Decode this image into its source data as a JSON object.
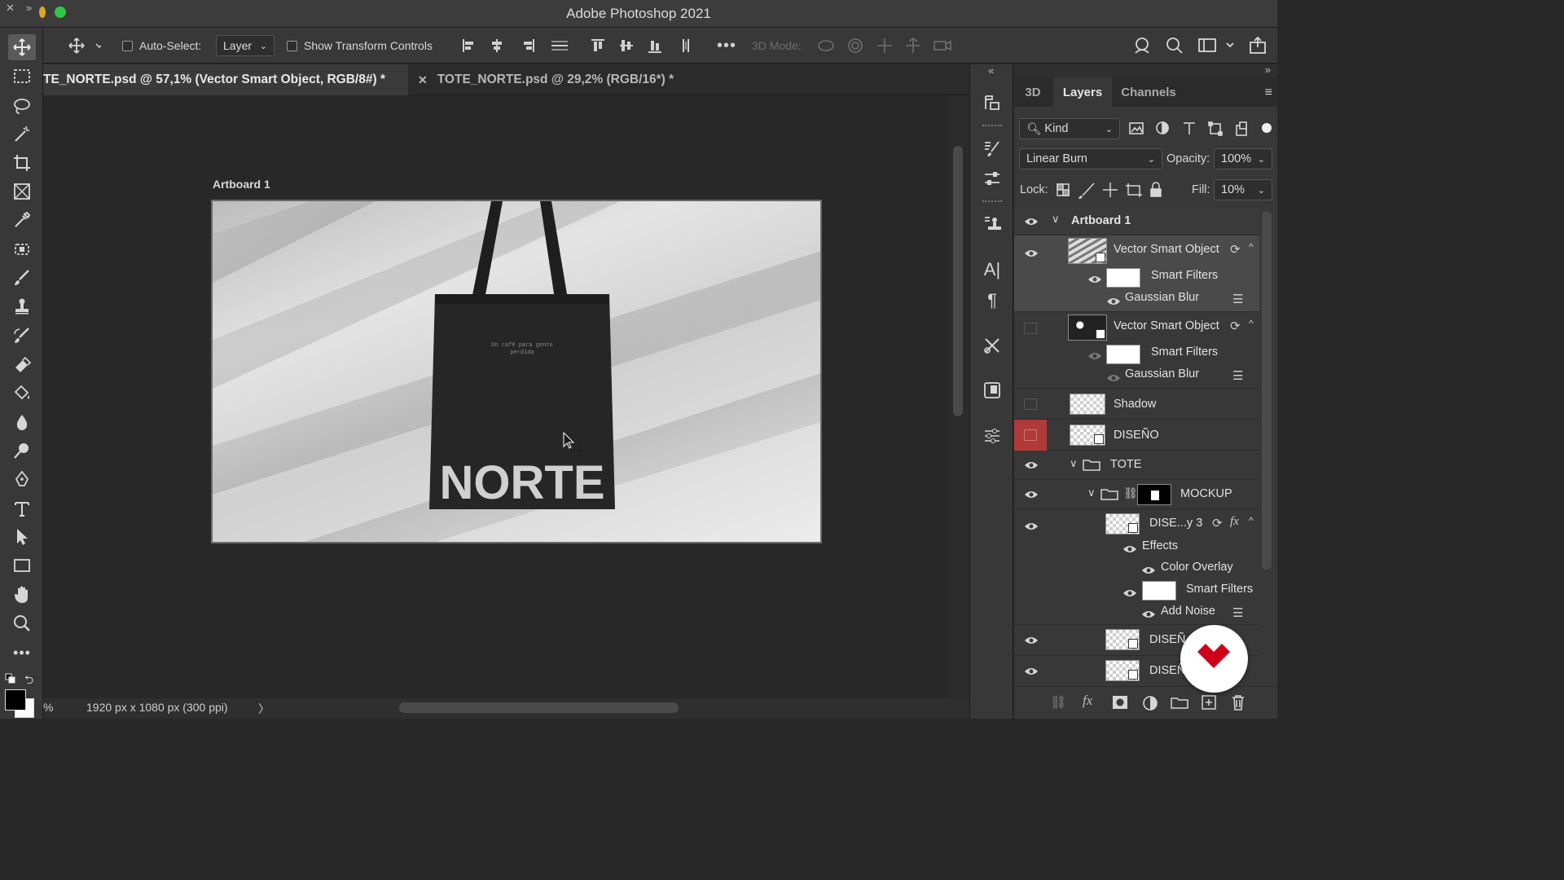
{
  "app": {
    "title": "Adobe Photoshop 2021"
  },
  "colors": {
    "accent_red": "#d0021b",
    "swatch_fg": "#000000",
    "swatch_bg": "#ffffff",
    "highlight_red": "#b03a3a"
  },
  "options_bar": {
    "auto_select_label": "Auto-Select:",
    "auto_select_target": "Layer",
    "show_transform_label": "Show Transform Controls",
    "mode_3d_label": "3D Mode:",
    "more_icon": "ellipsis-icon"
  },
  "tabs": [
    {
      "label": "TE_NORTE.psd @ 57,1% (Vector Smart Object, RGB/8#) *",
      "active": true
    },
    {
      "label": "TOTE_NORTE.psd @ 29,2% (RGB/16*) *",
      "active": false
    }
  ],
  "canvas": {
    "artboard_label": "Artboard 1",
    "bag_small_text_1": "Un café para gente",
    "bag_small_text_2": "perdida",
    "bag_big_text": "NORTE"
  },
  "status": {
    "zoom_label": "%",
    "doc_info": "1920 px x 1080 px (300 ppi)",
    "arrow": "〉"
  },
  "panel": {
    "tabs": [
      "3D",
      "Layers",
      "Channels"
    ],
    "active_tab": "Layers",
    "filter_kind": "Kind",
    "blend_mode": "Linear Burn",
    "opacity_label": "Opacity:",
    "opacity_value": "100%",
    "lock_label": "Lock:",
    "fill_label": "Fill:",
    "fill_value": "10%",
    "layers": {
      "artboard": "Artboard 1",
      "vso1": "Vector Smart Object",
      "vso1_filters": "Smart Filters",
      "vso1_blur": "Gaussian Blur",
      "vso2": "Vector Smart Object",
      "vso2_filters": "Smart Filters",
      "vso2_blur": "Gaussian Blur",
      "shadow": "Shadow",
      "diseno": "DISEÑO",
      "tote": "TOTE",
      "mockup": "MOCKUP",
      "dise3": "DISE...y 3",
      "fx": "fx",
      "effects": "Effects",
      "color_overlay": "Color Overlay",
      "smart_filters3": "Smart Filters",
      "add_noise": "Add Noise",
      "dise_a": "DISEÑ",
      "dise_b": "DISEÑ"
    }
  }
}
